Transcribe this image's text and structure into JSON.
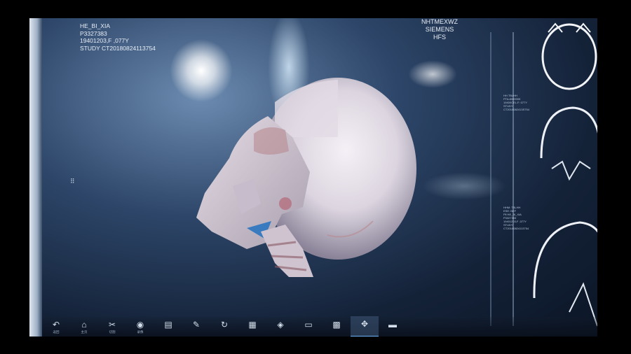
{
  "patient": {
    "name": "HE_BI_XIA",
    "id": "P3327383",
    "dob_sex_age": "19401203,F ,077Y",
    "study": "STUDY CT20180824113754"
  },
  "scanner": {
    "site": "NHTMEXWZ",
    "vendor": "SIEMENS",
    "position": "HFS"
  },
  "side_panel": {
    "blocks": [
      [
        "HH TBLHH",
        "PTA:8999999",
        "19400CEL.F: 077Y",
        "STUDY CT2018082413S754"
      ],
      [
        "HHM: TBLHH",
        "ESE: BEF",
        "Pll HE_BI_XIA",
        "P3327383",
        "19401203,F ,077Y",
        "STUDY CT20180824113754"
      ]
    ]
  },
  "toolbar": {
    "items": [
      {
        "icon": "back-icon",
        "glyph": "↶",
        "label": "返回"
      },
      {
        "icon": "home-icon",
        "glyph": "⌂",
        "label": "主页"
      },
      {
        "icon": "scissors-icon",
        "glyph": "✂",
        "label": "切割"
      },
      {
        "icon": "record-icon",
        "glyph": "◉",
        "label": "录像"
      },
      {
        "icon": "book-icon",
        "glyph": "▤",
        "label": ""
      },
      {
        "icon": "brush-icon",
        "glyph": "✎",
        "label": ""
      },
      {
        "icon": "rotate-icon",
        "glyph": "↻",
        "label": ""
      },
      {
        "icon": "layout-icon",
        "glyph": "▦",
        "label": ""
      },
      {
        "icon": "layers-icon",
        "glyph": "◈",
        "label": ""
      },
      {
        "icon": "window-icon",
        "glyph": "▭",
        "label": ""
      },
      {
        "icon": "palette-icon",
        "glyph": "▩",
        "label": ""
      },
      {
        "icon": "move-icon",
        "glyph": "✥",
        "label": ""
      },
      {
        "icon": "screen-icon",
        "glyph": "▬",
        "label": ""
      }
    ],
    "active_index": 11
  },
  "colors": {
    "bone": "#e9e4ea",
    "accent": "#6fb4ff"
  }
}
